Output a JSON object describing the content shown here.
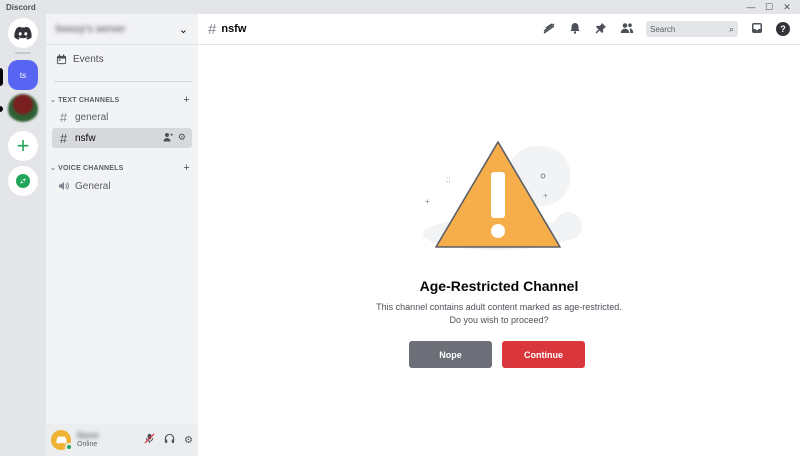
{
  "app": {
    "title": "Discord"
  },
  "window_controls": {
    "minimize": "—",
    "maximize": "☐",
    "close": "✕"
  },
  "server": {
    "name": "boozy's server",
    "events_label": "Events"
  },
  "rail": {
    "active_server_initials": "ts",
    "add_symbol": "+"
  },
  "categories": {
    "text": {
      "label": "TEXT CHANNELS"
    },
    "voice": {
      "label": "VOICE CHANNELS"
    }
  },
  "channels": {
    "text": [
      {
        "name": "general",
        "active": false
      },
      {
        "name": "nsfw",
        "active": true
      }
    ],
    "voice": [
      {
        "name": "General"
      }
    ]
  },
  "user": {
    "name": "Name",
    "status": "Online"
  },
  "topbar": {
    "channel_name": "nsfw",
    "search_placeholder": "Search"
  },
  "gate": {
    "title": "Age-Restricted Channel",
    "line1": "This channel contains adult content marked as age-restricted.",
    "line2": "Do you wish to proceed?",
    "nope_label": "Nope",
    "continue_label": "Continue"
  },
  "colors": {
    "blurple": "#5865f2",
    "danger": "#da373c",
    "secondary": "#6d6f78",
    "warning": "#f0b232",
    "online": "#23a559"
  },
  "icons": [
    "discord-logo-icon",
    "calendar-icon",
    "hash-icon",
    "speaker-icon",
    "threads-icon",
    "bell-icon",
    "pin-icon",
    "members-icon",
    "search-icon",
    "inbox-icon",
    "help-icon",
    "mute-icon",
    "headphones-icon",
    "gear-icon",
    "compass-icon",
    "warning-triangle-icon"
  ]
}
